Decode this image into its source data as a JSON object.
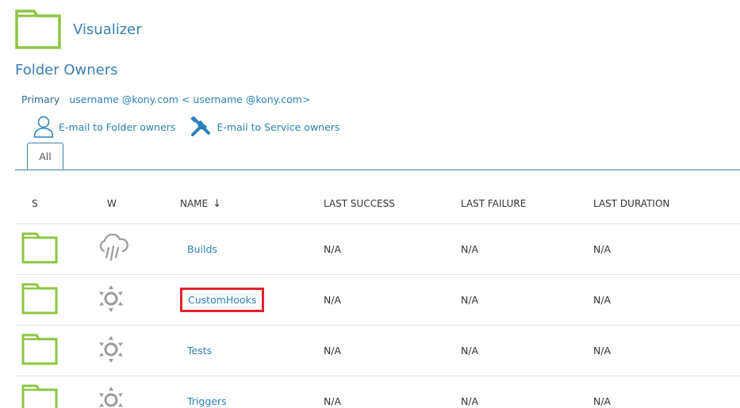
{
  "header": {
    "title": "Visualizer",
    "icon": "folder-icon"
  },
  "owners": {
    "section_title": "Folder Owners",
    "primary_label": "Primary",
    "primary_value": "username @kony.com < username @kony.com>",
    "email_folder_owners": "E-mail to Folder owners",
    "email_service_owners": "E-mail to Service owners"
  },
  "tabs": [
    {
      "label": "All",
      "active": true
    }
  ],
  "table": {
    "columns": {
      "s": "S",
      "w": "W",
      "name": "NAME",
      "sort_indicator": "↓",
      "last_success": "LAST SUCCESS",
      "last_failure": "LAST FAILURE",
      "last_duration": "LAST DURATION"
    },
    "rows": [
      {
        "status_icon": "folder-icon",
        "weather_icon": "cloud-rain-icon",
        "name": "Builds",
        "last_success": "N/A",
        "last_failure": "N/A",
        "last_duration": "N/A"
      },
      {
        "status_icon": "folder-icon",
        "weather_icon": "sun-icon",
        "name": "CustomHooks",
        "last_success": "N/A",
        "last_failure": "N/A",
        "last_duration": "N/A",
        "highlighted": true
      },
      {
        "status_icon": "folder-icon",
        "weather_icon": "sun-icon",
        "name": "Tests",
        "last_success": "N/A",
        "last_failure": "N/A",
        "last_duration": "N/A"
      },
      {
        "status_icon": "folder-icon",
        "weather_icon": "sun-icon",
        "name": "Triggers",
        "last_success": "N/A",
        "last_failure": "N/A",
        "last_duration": "N/A"
      }
    ]
  },
  "colors": {
    "folder_green": "#8dc63f",
    "link_blue": "#2a80b9",
    "title_blue": "#3a7fb0",
    "highlight_red": "#e2232a",
    "icon_gray": "#9a9a9a"
  }
}
